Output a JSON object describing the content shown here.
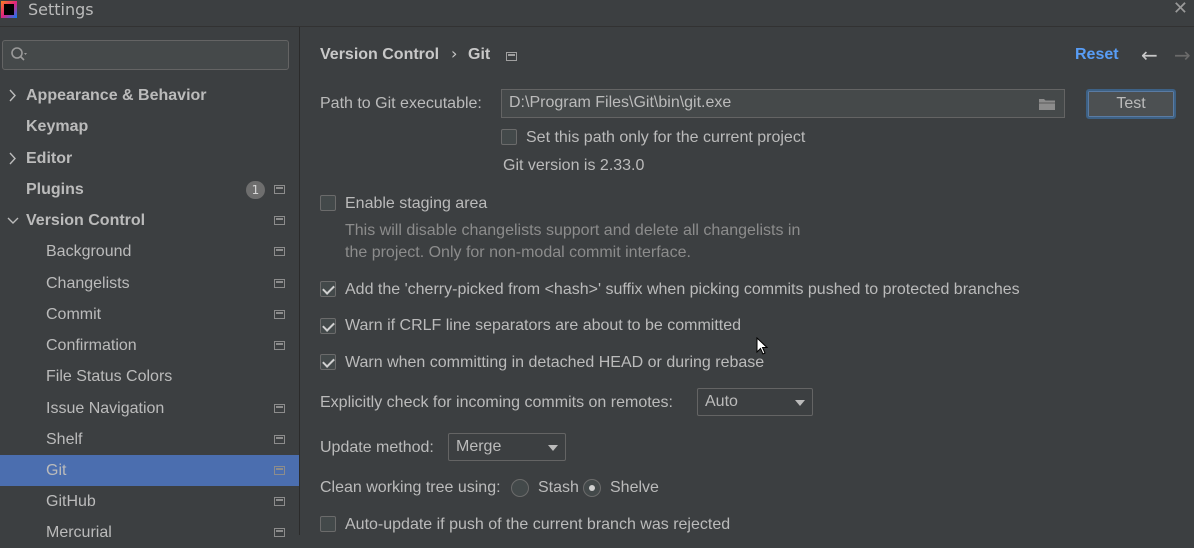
{
  "window": {
    "title": "Settings"
  },
  "sidebar": {
    "search_placeholder": "",
    "items": [
      {
        "label": "Appearance & Behavior",
        "bold": true,
        "arrow": "right"
      },
      {
        "label": "Keymap",
        "bold": true
      },
      {
        "label": "Editor",
        "bold": true,
        "arrow": "right"
      },
      {
        "label": "Plugins",
        "bold": true,
        "badge": "1"
      },
      {
        "label": "Version Control",
        "bold": true,
        "arrow": "down"
      },
      {
        "label": "Background"
      },
      {
        "label": "Changelists"
      },
      {
        "label": "Commit"
      },
      {
        "label": "Confirmation"
      },
      {
        "label": "File Status Colors"
      },
      {
        "label": "Issue Navigation"
      },
      {
        "label": "Shelf"
      },
      {
        "label": "Git",
        "selected": true
      },
      {
        "label": "GitHub"
      },
      {
        "label": "Mercurial"
      }
    ]
  },
  "header": {
    "breadcrumb_parent": "Version Control",
    "breadcrumb_separator": "›",
    "breadcrumb_current": "Git",
    "reset_label": "Reset",
    "back_icon": "arrow-left-icon",
    "forward_icon": "arrow-right-icon"
  },
  "git": {
    "path_label": "Path to Git executable:",
    "path_value": "D:\\Program Files\\Git\\bin\\git.exe",
    "test_label": "Test",
    "project_only_label": "Set this path only for the current project",
    "project_only_checked": false,
    "version_text": "Git version is 2.33.0",
    "staging_label": "Enable staging area",
    "staging_checked": false,
    "staging_hint_1": "This will disable changelists support and delete all changelists in",
    "staging_hint_2": "the project. Only for non-modal commit interface.",
    "cherry_label": "Add the 'cherry-picked from <hash>' suffix when picking commits pushed to protected branches",
    "cherry_checked": true,
    "crlf_label": "Warn if CRLF line separators are about to be committed",
    "crlf_checked": true,
    "detached_label": "Warn when committing in detached HEAD or during rebase",
    "detached_checked": true,
    "incoming_label": "Explicitly check for incoming commits on remotes:",
    "incoming_value": "Auto",
    "update_label": "Update method:",
    "update_value": "Merge",
    "clean_label": "Clean working tree using:",
    "clean_options": [
      "Stash",
      "Shelve"
    ],
    "clean_selected": "Shelve",
    "autoupdate_label": "Auto-update if push of the current branch was rejected",
    "autoupdate_checked": false
  }
}
